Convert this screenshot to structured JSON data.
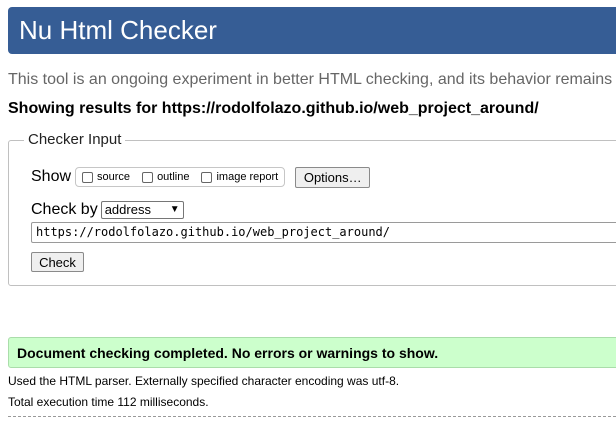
{
  "header": {
    "title": "Nu Html Checker"
  },
  "intro": {
    "text": "This tool is an ongoing experiment in better HTML checking, and its behavior remains"
  },
  "results_heading": "Showing results for https://rodolfolazo.github.io/web_project_around/",
  "checker_input": {
    "legend": "Checker Input",
    "show_label": "Show",
    "checkboxes": [
      {
        "label": "source",
        "checked": false
      },
      {
        "label": "outline",
        "checked": false
      },
      {
        "label": "image report",
        "checked": false
      }
    ],
    "options_button": "Options…",
    "check_by_label": "Check by",
    "check_by_value": "address",
    "url_value": "https://rodolfolazo.github.io/web_project_around/",
    "check_button": "Check"
  },
  "result": {
    "success_message": "Document checking completed. No errors or warnings to show.",
    "parser_info": "Used the HTML parser. Externally specified character encoding was utf-8.",
    "execution_time": "Total execution time 112 milliseconds."
  },
  "colors": {
    "header_bg": "#365d95",
    "success_bg": "#ccffcc",
    "intro_text": "#666666"
  }
}
